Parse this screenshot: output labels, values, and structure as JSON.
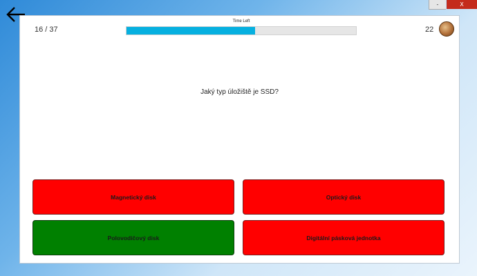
{
  "window": {
    "minimize_label": "-",
    "close_label": "X"
  },
  "header": {
    "counter": "16 / 37",
    "time_left_label": "Time Left",
    "time_left_fraction": 0.56,
    "score": "22"
  },
  "question": "Jaký typ úložiště je SSD?",
  "answers": [
    {
      "label": "Magnetický disk",
      "color": "#ff0000"
    },
    {
      "label": "Optický disk",
      "color": "#ff0000"
    },
    {
      "label": "Polovodičový disk",
      "color": "#008000"
    },
    {
      "label": "Digitální pásková jednotka",
      "color": "#ff0000"
    }
  ],
  "colors": {
    "progress": "#06b0e0",
    "wrong": "#ff0000",
    "correct": "#008000"
  }
}
